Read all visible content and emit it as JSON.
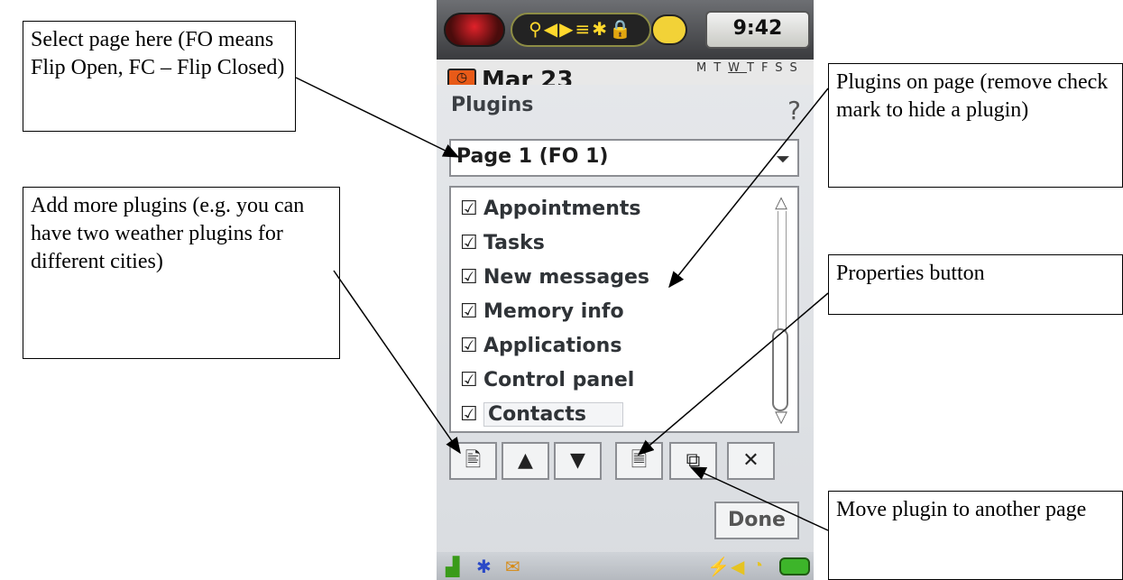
{
  "callouts": {
    "select_page": "Select page here (FO means Flip Open, FC – Flip Closed)",
    "add_plugins": "Add more plugins (e.g. you can have two weather plugins for different cities)",
    "plugins_on_page": "Plugins on page (remove check mark to hide a plugin)",
    "properties": "Properties button",
    "move_plugin": "Move plugin to another page"
  },
  "status": {
    "time": "9:42",
    "date": "Mar 23",
    "weekdays": [
      "M",
      "T",
      "W",
      "T",
      "F",
      "S",
      "S"
    ],
    "current_weekday_index": 2,
    "status_icons": "⚲◀▶≡✱🔒"
  },
  "dialog": {
    "title": "Plugins",
    "help_glyph": "?",
    "page_selector": "Page 1 (FO 1)",
    "dropdown_glyph": "⏷",
    "check_glyph": "☑",
    "plugins": [
      {
        "label": "Appointments",
        "checked": true
      },
      {
        "label": "Tasks",
        "checked": true
      },
      {
        "label": "New messages",
        "checked": true
      },
      {
        "label": "Memory info",
        "checked": true
      },
      {
        "label": "Applications",
        "checked": true
      },
      {
        "label": "Control panel",
        "checked": true
      },
      {
        "label": "Contacts",
        "checked": true,
        "selected": true
      }
    ],
    "toolbar": [
      {
        "name": "add-plugin-button",
        "glyph": "🖹"
      },
      {
        "name": "move-up-button",
        "glyph": "▲"
      },
      {
        "name": "move-down-button",
        "glyph": "▼"
      },
      {
        "name": "properties-button",
        "glyph": "🗎"
      },
      {
        "name": "move-to-page-button",
        "glyph": "⧉"
      },
      {
        "name": "delete-button",
        "glyph": "✕"
      }
    ],
    "done_label": "Done"
  }
}
